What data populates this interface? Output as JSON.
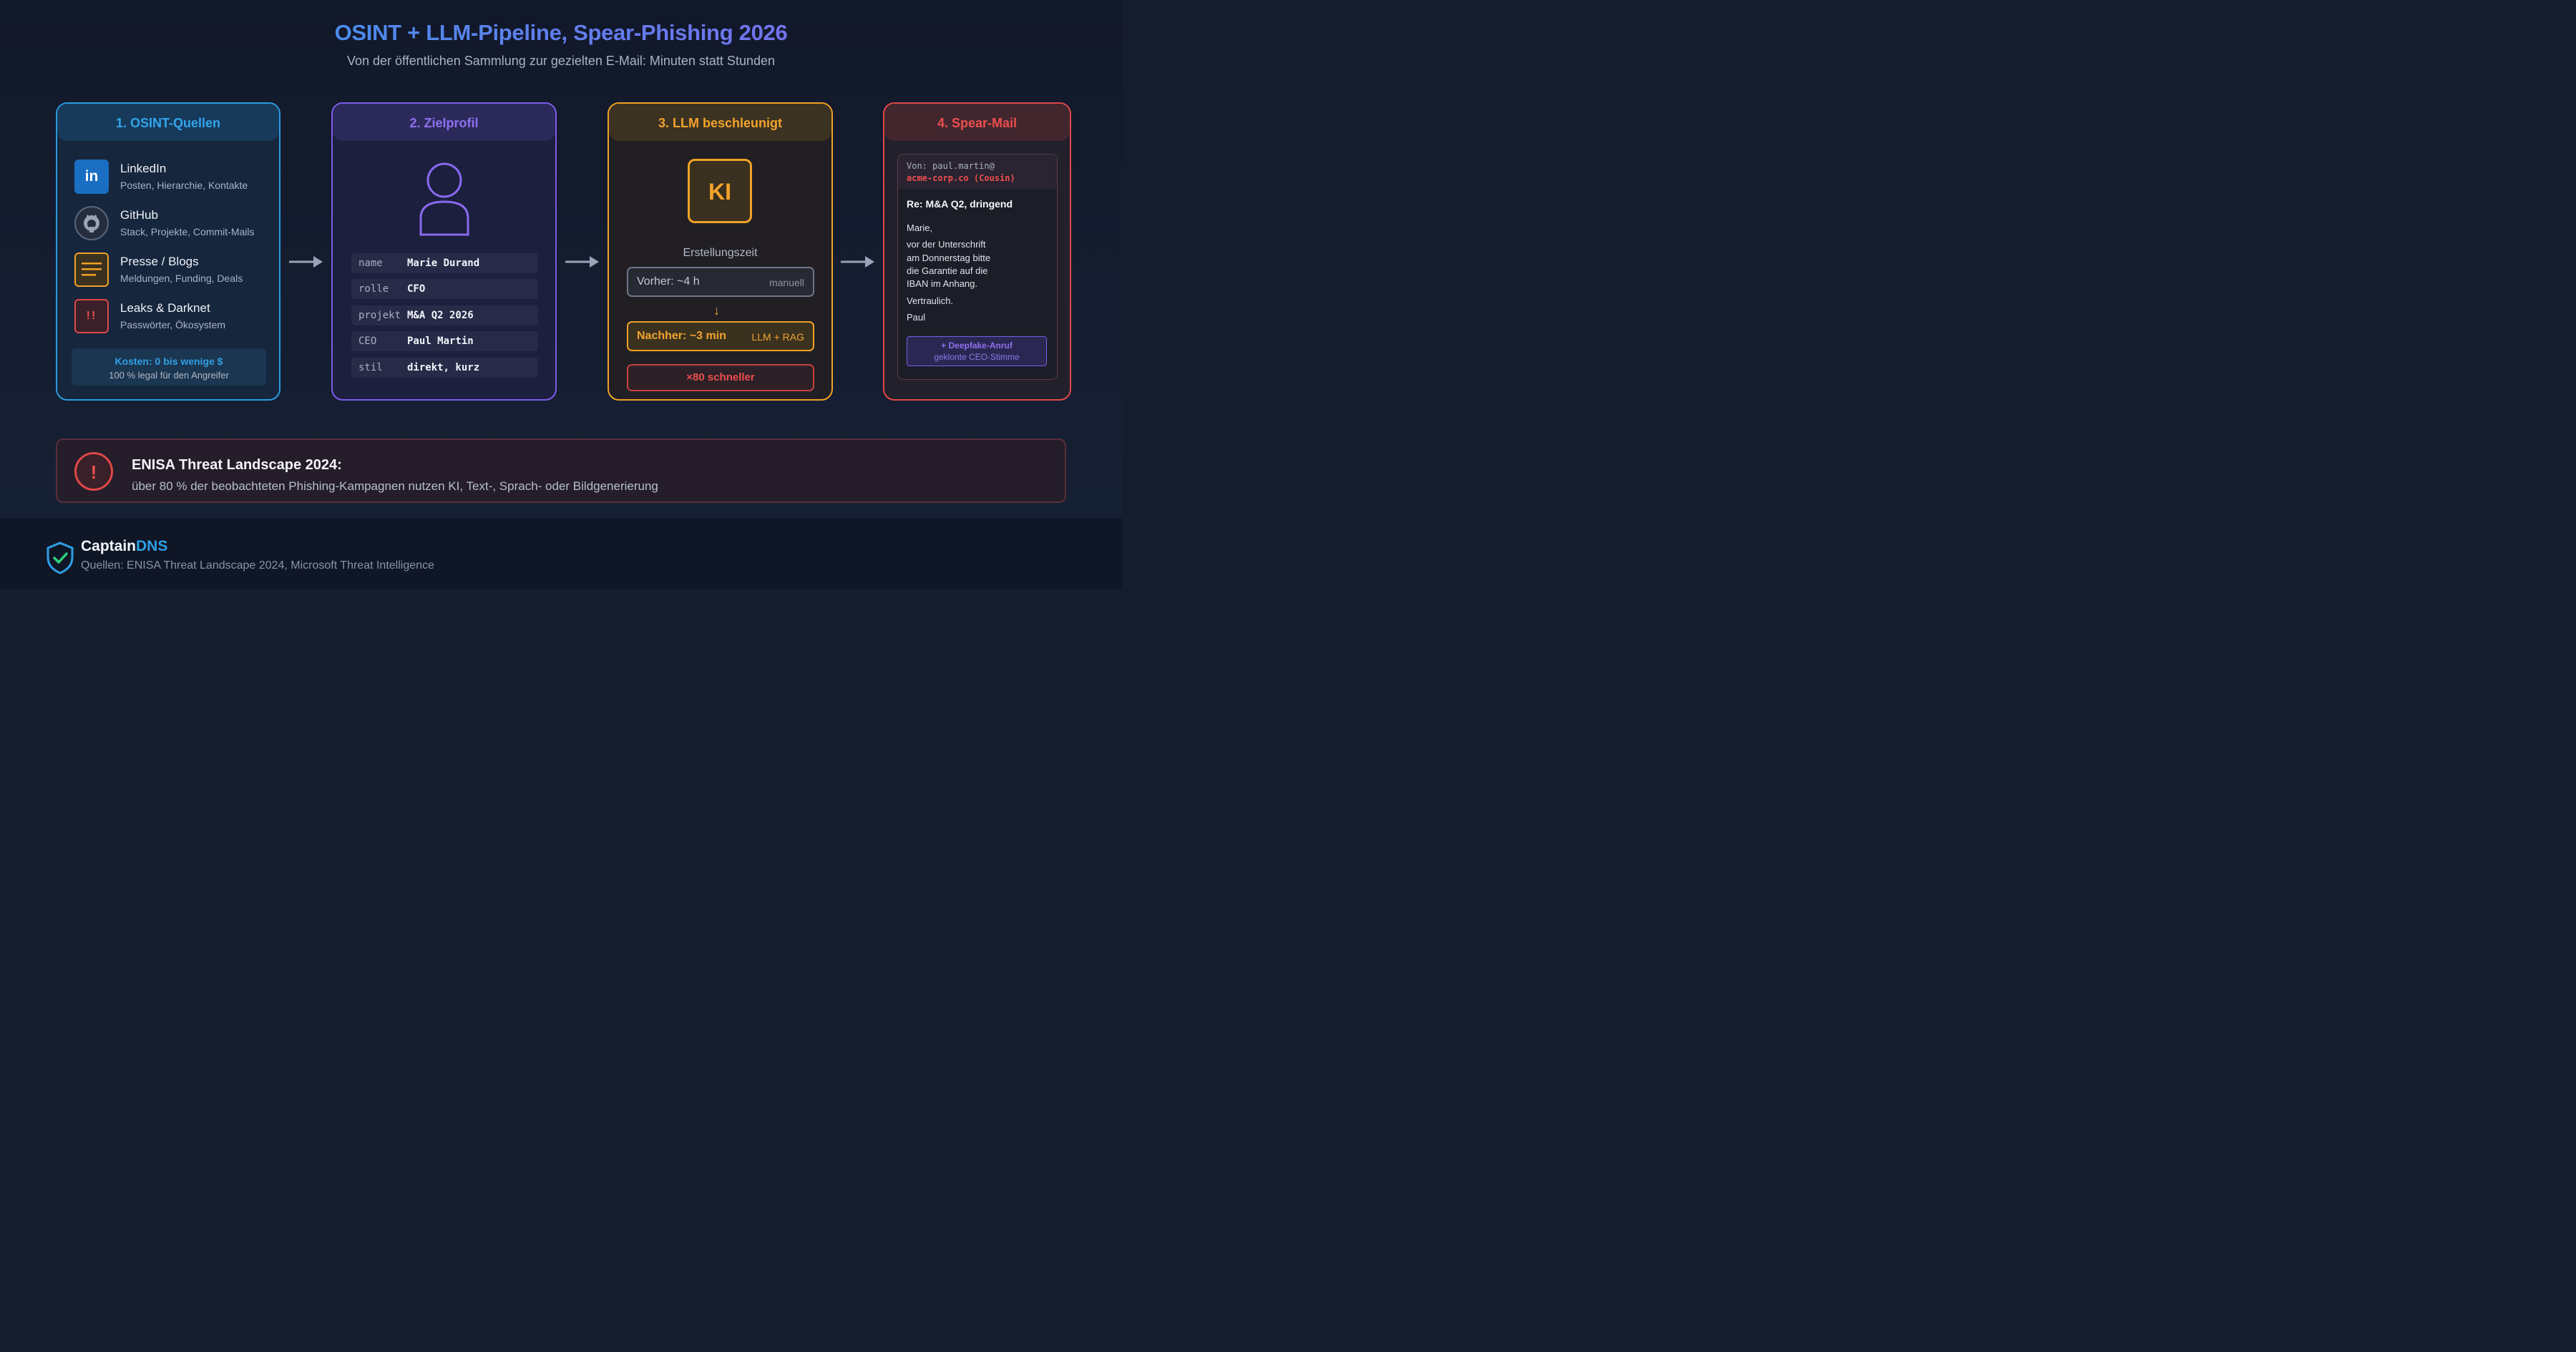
{
  "header": {
    "title": "OSINT + LLM-Pipeline, Spear-Phishing 2026",
    "subtitle": "Von der öffentlichen Sammlung zur gezielten E-Mail: Minuten statt Stunden"
  },
  "cards": {
    "osint": {
      "title": "1. OSINT-Quellen",
      "sources": [
        {
          "name": "LinkedIn",
          "desc": "Posten, Hierarchie, Kontakte",
          "icon": "linkedin-icon",
          "icon_text": "in"
        },
        {
          "name": "GitHub",
          "desc": "Stack, Projekte, Commit-Mails",
          "icon": "github-icon"
        },
        {
          "name": "Presse / Blogs",
          "desc": "Meldungen, Funding, Deals",
          "icon": "document-lines-icon"
        },
        {
          "name": "Leaks & Darknet",
          "desc": "Passwörter, Ökosystem",
          "icon": "alert-icon",
          "icon_text": "!!"
        }
      ],
      "cost_title": "Kosten: 0 bis wenige $",
      "cost_sub": "100 % legal für den Angreifer"
    },
    "profile": {
      "title": "2. Zielprofil",
      "rows": [
        {
          "key": "name",
          "value": "Marie Durand"
        },
        {
          "key": "rolle",
          "value": "CFO"
        },
        {
          "key": "projekt",
          "value": "M&A Q2 2026"
        },
        {
          "key": "CEO",
          "value": "Paul Martin"
        },
        {
          "key": "stil",
          "value": "direkt, kurz"
        }
      ]
    },
    "llm": {
      "title": "3. LLM beschleunigt",
      "badge": "KI",
      "time_label": "Erstellungszeit",
      "before_label": "Vorher: ~4 h",
      "before_tag": "manuell",
      "after_label": "Nachher: ~3 min",
      "after_tag": "LLM + RAG",
      "speedup": "×80 schneller"
    },
    "mail": {
      "title": "4. Spear-Mail",
      "from_line1": "Von: paul.martin@",
      "from_line2": "acme-corp.co (Cousin)",
      "subject": "Re: M&A Q2, dringend",
      "greeting": "Marie,",
      "body_lines": [
        "vor der Unterschrift",
        "am Donnerstag bitte",
        "die Garantie auf die",
        "IBAN im Anhang."
      ],
      "confidential": "Vertraulich.",
      "signature": "Paul",
      "deepfake_title": "+ Deepfake-Anruf",
      "deepfake_sub": "geklonte CEO-Stimme"
    }
  },
  "alert": {
    "icon_text": "!",
    "title": "ENISA Threat Landscape 2024:",
    "text": "über 80 % der beobachteten Phishing-Kampagnen nutzen KI, Text-, Sprach- oder Bildgenerierung"
  },
  "footer": {
    "brand_a": "Captain",
    "brand_b": "DNS",
    "sources": "Quellen: ENISA Threat Landscape 2024, Microsoft Threat Intelligence"
  },
  "colors": {
    "blue": "#2a9be0",
    "purple": "#7b5ce8",
    "orange": "#f0a224",
    "red": "#e04848",
    "background": "#141c2d"
  }
}
